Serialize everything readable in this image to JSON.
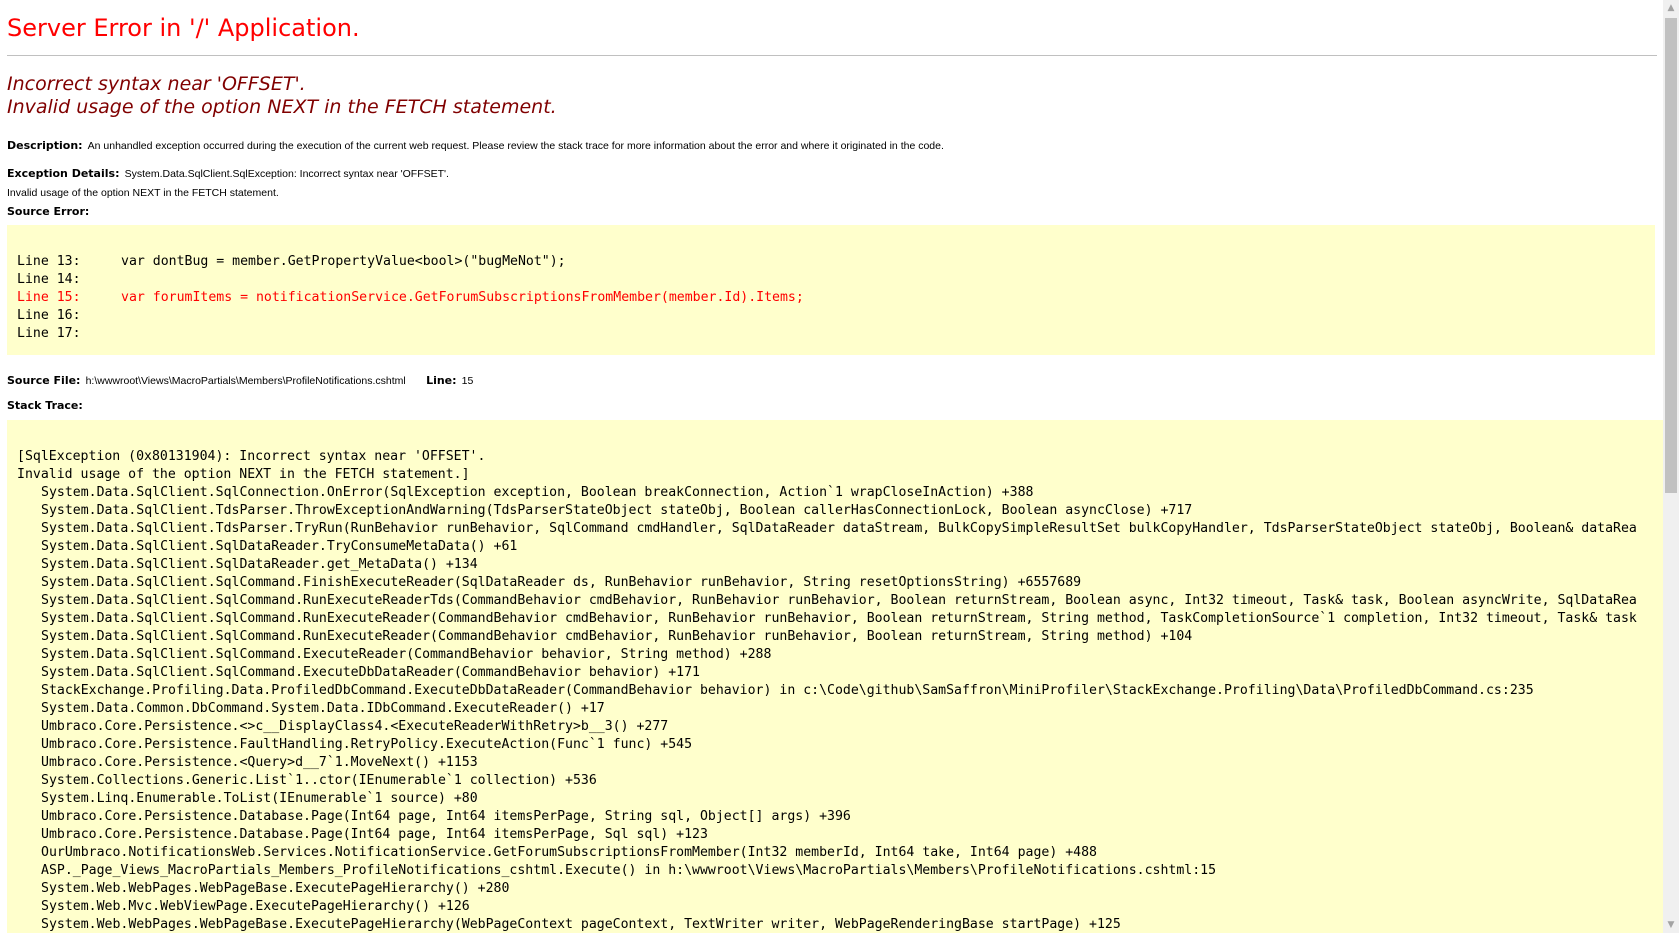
{
  "page": {
    "title": "Server Error in '/' Application.",
    "headline": [
      "Incorrect syntax near 'OFFSET'.",
      "Invalid usage of the option NEXT in the FETCH statement."
    ],
    "description_label": "Description:",
    "description_text": "An unhandled exception occurred during the execution of the current web request. Please review the stack trace for more information about the error and where it originated in the code.",
    "exception_label": "Exception Details:",
    "exception_text_1": "System.Data.SqlClient.SqlException: Incorrect syntax near 'OFFSET'.",
    "exception_text_2": "Invalid usage of the option NEXT in the FETCH statement.",
    "source_error_label": "Source Error:",
    "source_lines": [
      {
        "num": "Line 13:",
        "code": "var dontBug = member.GetPropertyValue<bool>(\"bugMeNot\");",
        "highlight": false
      },
      {
        "num": "Line 14:",
        "code": "",
        "highlight": false
      },
      {
        "num": "Line 15:",
        "code": "var forumItems = notificationService.GetForumSubscriptionsFromMember(member.Id).Items;",
        "highlight": true
      },
      {
        "num": "Line 16:",
        "code": "",
        "highlight": false
      },
      {
        "num": "Line 17:",
        "code": "",
        "highlight": false
      }
    ],
    "source_file_label": "Source File:",
    "source_file_value": "h:\\wwwroot\\Views\\MacroPartials\\Members\\ProfileNotifications.cshtml",
    "line_label": "Line:",
    "line_value": "15",
    "stack_trace_label": "Stack Trace:",
    "stack_header": [
      "[SqlException (0x80131904): Incorrect syntax near 'OFFSET'.",
      "Invalid usage of the option NEXT in the FETCH statement.]"
    ],
    "stack_frames": [
      "System.Data.SqlClient.SqlConnection.OnError(SqlException exception, Boolean breakConnection, Action`1 wrapCloseInAction) +388",
      "System.Data.SqlClient.TdsParser.ThrowExceptionAndWarning(TdsParserStateObject stateObj, Boolean callerHasConnectionLock, Boolean asyncClose) +717",
      "System.Data.SqlClient.TdsParser.TryRun(RunBehavior runBehavior, SqlCommand cmdHandler, SqlDataReader dataStream, BulkCopySimpleResultSet bulkCopyHandler, TdsParserStateObject stateObj, Boolean& dataRea",
      "System.Data.SqlClient.SqlDataReader.TryConsumeMetaData() +61",
      "System.Data.SqlClient.SqlDataReader.get_MetaData() +134",
      "System.Data.SqlClient.SqlCommand.FinishExecuteReader(SqlDataReader ds, RunBehavior runBehavior, String resetOptionsString) +6557689",
      "System.Data.SqlClient.SqlCommand.RunExecuteReaderTds(CommandBehavior cmdBehavior, RunBehavior runBehavior, Boolean returnStream, Boolean async, Int32 timeout, Task& task, Boolean asyncWrite, SqlDataRea",
      "System.Data.SqlClient.SqlCommand.RunExecuteReader(CommandBehavior cmdBehavior, RunBehavior runBehavior, Boolean returnStream, String method, TaskCompletionSource`1 completion, Int32 timeout, Task& task",
      "System.Data.SqlClient.SqlCommand.RunExecuteReader(CommandBehavior cmdBehavior, RunBehavior runBehavior, Boolean returnStream, String method) +104",
      "System.Data.SqlClient.SqlCommand.ExecuteReader(CommandBehavior behavior, String method) +288",
      "System.Data.SqlClient.SqlCommand.ExecuteDbDataReader(CommandBehavior behavior) +171",
      "StackExchange.Profiling.Data.ProfiledDbCommand.ExecuteDbDataReader(CommandBehavior behavior) in c:\\Code\\github\\SamSaffron\\MiniProfiler\\StackExchange.Profiling\\Data\\ProfiledDbCommand.cs:235",
      "System.Data.Common.DbCommand.System.Data.IDbCommand.ExecuteReader() +17",
      "Umbraco.Core.Persistence.<>c__DisplayClass4.<ExecuteReaderWithRetry>b__3() +277",
      "Umbraco.Core.Persistence.FaultHandling.RetryPolicy.ExecuteAction(Func`1 func) +545",
      "Umbraco.Core.Persistence.<Query>d__7`1.MoveNext() +1153",
      "System.Collections.Generic.List`1..ctor(IEnumerable`1 collection) +536",
      "System.Linq.Enumerable.ToList(IEnumerable`1 source) +80",
      "Umbraco.Core.Persistence.Database.Page(Int64 page, Int64 itemsPerPage, String sql, Object[] args) +396",
      "Umbraco.Core.Persistence.Database.Page(Int64 page, Int64 itemsPerPage, Sql sql) +123",
      "OurUmbraco.NotificationsWeb.Services.NotificationService.GetForumSubscriptionsFromMember(Int32 memberId, Int64 take, Int64 page) +488",
      "ASP._Page_Views_MacroPartials_Members_ProfileNotifications_cshtml.Execute() in h:\\wwwroot\\Views\\MacroPartials\\Members\\ProfileNotifications.cshtml:15",
      "System.Web.WebPages.WebPageBase.ExecutePageHierarchy() +280",
      "System.Web.Mvc.WebViewPage.ExecutePageHierarchy() +126",
      "System.Web.WebPages.WebPageBase.ExecutePageHierarchy(WebPageContext pageContext, TextWriter writer, WebPageRenderingBase startPage) +125"
    ]
  },
  "scrollbar": {
    "up_icon": "▲",
    "down_icon": "▼"
  },
  "colors": {
    "title": "#ff0000",
    "headline": "#800000",
    "code_background": "#ffffcc",
    "highlight_line": "#ff0000"
  }
}
